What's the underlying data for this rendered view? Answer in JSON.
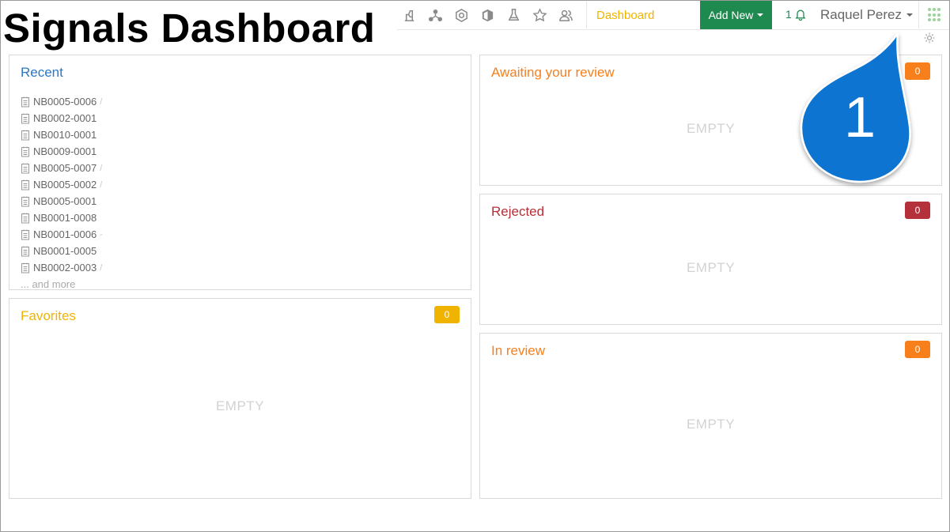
{
  "title": "Signals Dashboard",
  "nav": {
    "icons": [
      "flask-stand-icon",
      "molecule-icon",
      "hexagon-icon",
      "cube-icon",
      "beaker-icon",
      "star-icon",
      "users-icon"
    ],
    "dashboard_label": "Dashboard",
    "add_new_label": "Add New",
    "notification_count": "1",
    "user_name": "Raquel Perez"
  },
  "panels": {
    "recent": {
      "title": "Recent",
      "items": [
        {
          "label": "NB0005-0006",
          "trail": "/"
        },
        {
          "label": "NB0002-0001",
          "trail": ""
        },
        {
          "label": "NB0010-0001",
          "trail": ""
        },
        {
          "label": "NB0009-0001",
          "trail": ""
        },
        {
          "label": "NB0005-0007",
          "trail": "/"
        },
        {
          "label": "NB0005-0002",
          "trail": "/"
        },
        {
          "label": "NB0005-0001",
          "trail": ""
        },
        {
          "label": "NB0001-0008",
          "trail": ""
        },
        {
          "label": "NB0001-0006",
          "trail": "-"
        },
        {
          "label": "NB0001-0005",
          "trail": ""
        },
        {
          "label": "NB0002-0003",
          "trail": "/"
        }
      ],
      "more": "... and more"
    },
    "favorites": {
      "title": "Favorites",
      "count": "0",
      "empty": "EMPTY"
    },
    "awaiting": {
      "title": "Awaiting your review",
      "count": "0",
      "empty": "EMPTY"
    },
    "rejected": {
      "title": "Rejected",
      "count": "0",
      "empty": "EMPTY"
    },
    "in_review": {
      "title": "In review",
      "count": "0",
      "empty": "EMPTY"
    }
  },
  "callout": {
    "number": "1"
  },
  "colors": {
    "accent_green": "#1e8a4f",
    "favorites": "#f0b400",
    "orange": "#f77f1c",
    "rejected": "#b4303a",
    "recent": "#2a78c8",
    "callout": "#0b74d1"
  }
}
